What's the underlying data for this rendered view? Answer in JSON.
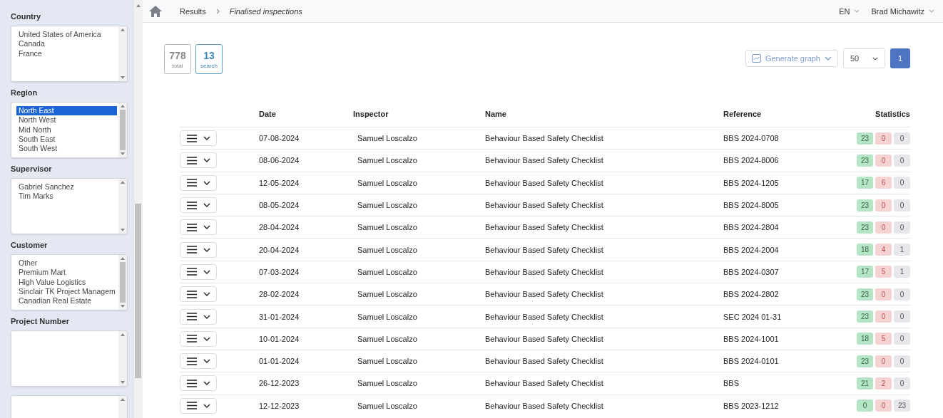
{
  "filters": [
    {
      "label": "Country",
      "items": [
        {
          "text": "United States of America",
          "selected": false
        },
        {
          "text": "Canada",
          "selected": false
        },
        {
          "text": "France",
          "selected": false
        }
      ],
      "scrollbar": false
    },
    {
      "label": "Region",
      "items": [
        {
          "text": "North East",
          "selected": true
        },
        {
          "text": "North West",
          "selected": false
        },
        {
          "text": "Mid North",
          "selected": false
        },
        {
          "text": "South East",
          "selected": false
        },
        {
          "text": "South West",
          "selected": false
        }
      ],
      "scrollbar": true
    },
    {
      "label": "Supervisor",
      "items": [
        {
          "text": "Gabriel Sanchez",
          "selected": false
        },
        {
          "text": "Tim Marks",
          "selected": false
        }
      ],
      "scrollbar": false
    },
    {
      "label": "Customer",
      "items": [
        {
          "text": "Other",
          "selected": false
        },
        {
          "text": "Premium Mart",
          "selected": false
        },
        {
          "text": "High Value Logistics",
          "selected": false
        },
        {
          "text": "Sinclair TK Project Managem",
          "selected": false
        },
        {
          "text": "Canadian Real Estate",
          "selected": false
        }
      ],
      "scrollbar": true
    },
    {
      "label": "Project Number",
      "scrollbar": false
    }
  ],
  "breadcrumb": [
    "Results",
    "Finalised inspections"
  ],
  "language": "EN",
  "user": "Brad Michawitz",
  "counts": [
    {
      "value": "778",
      "label": "total",
      "kind": "total"
    },
    {
      "value": "13",
      "label": "search",
      "kind": "search"
    }
  ],
  "graph_button": "Generate graph",
  "page_size": "50",
  "page": "1",
  "table": {
    "columns": [
      "Date",
      "Inspector",
      "Name",
      "Reference",
      "Statistics"
    ],
    "rows": [
      {
        "date": "07-08-2024",
        "inspector": "Samuel Loscalzo",
        "name": "Behaviour Based Safety Checklist",
        "reference": "BBS 2024-0708",
        "stats": [
          "23",
          "0",
          "0"
        ]
      },
      {
        "date": "08-06-2024",
        "inspector": "Samuel Loscalzo",
        "name": "Behaviour Based Safety Checklist",
        "reference": "BBS 2024-8006",
        "stats": [
          "23",
          "0",
          "0"
        ]
      },
      {
        "date": "12-05-2024",
        "inspector": "Samuel Loscalzo",
        "name": "Behaviour Based Safety Checklist",
        "reference": "BBS 2024-1205",
        "stats": [
          "17",
          "6",
          "0"
        ]
      },
      {
        "date": "08-05-2024",
        "inspector": "Samuel Loscalzo",
        "name": "Behaviour Based Safety Checklist",
        "reference": "BBS 2024-8005",
        "stats": [
          "23",
          "0",
          "0"
        ]
      },
      {
        "date": "28-04-2024",
        "inspector": "Samuel Loscalzo",
        "name": "Behaviour Based Safety Checklist",
        "reference": "BBS 2024-2804",
        "stats": [
          "23",
          "0",
          "0"
        ]
      },
      {
        "date": "20-04-2024",
        "inspector": "Samuel Loscalzo",
        "name": "Behaviour Based Safety Checklist",
        "reference": "BBS 2024-2004",
        "stats": [
          "18",
          "4",
          "1"
        ]
      },
      {
        "date": "07-03-2024",
        "inspector": "Samuel Loscalzo",
        "name": "Behaviour Based Safety Checklist",
        "reference": "BBS 2024-0307",
        "stats": [
          "17",
          "5",
          "1"
        ]
      },
      {
        "date": "28-02-2024",
        "inspector": "Samuel Loscalzo",
        "name": "Behaviour Based Safety Checklist",
        "reference": "BBS 2024-2802",
        "stats": [
          "23",
          "0",
          "0"
        ]
      },
      {
        "date": "31-01-2024",
        "inspector": "Samuel Loscalzo",
        "name": "Behaviour Based Safety Checklist",
        "reference": "SEC 2024 01-31",
        "stats": [
          "23",
          "0",
          "0"
        ]
      },
      {
        "date": "10-01-2024",
        "inspector": "Samuel Loscalzo",
        "name": "Behaviour Based Safety Checklist",
        "reference": "BBS 2024-1001",
        "stats": [
          "18",
          "5",
          "0"
        ]
      },
      {
        "date": "01-01-2024",
        "inspector": "Samuel Loscalzo",
        "name": "Behaviour Based Safety Checklist",
        "reference": "BBS 2024-0101",
        "stats": [
          "23",
          "0",
          "0"
        ]
      },
      {
        "date": "26-12-2023",
        "inspector": "Samuel Loscalzo",
        "name": "Behaviour Based Safety Checklist",
        "reference": "BBS",
        "stats": [
          "21",
          "2",
          "0"
        ]
      },
      {
        "date": "12-12-2023",
        "inspector": "Samuel Loscalzo",
        "name": "Behaviour Based Safety Checklist",
        "reference": "BBS 2023-1212",
        "stats": [
          "0",
          "0",
          "23"
        ]
      }
    ]
  }
}
